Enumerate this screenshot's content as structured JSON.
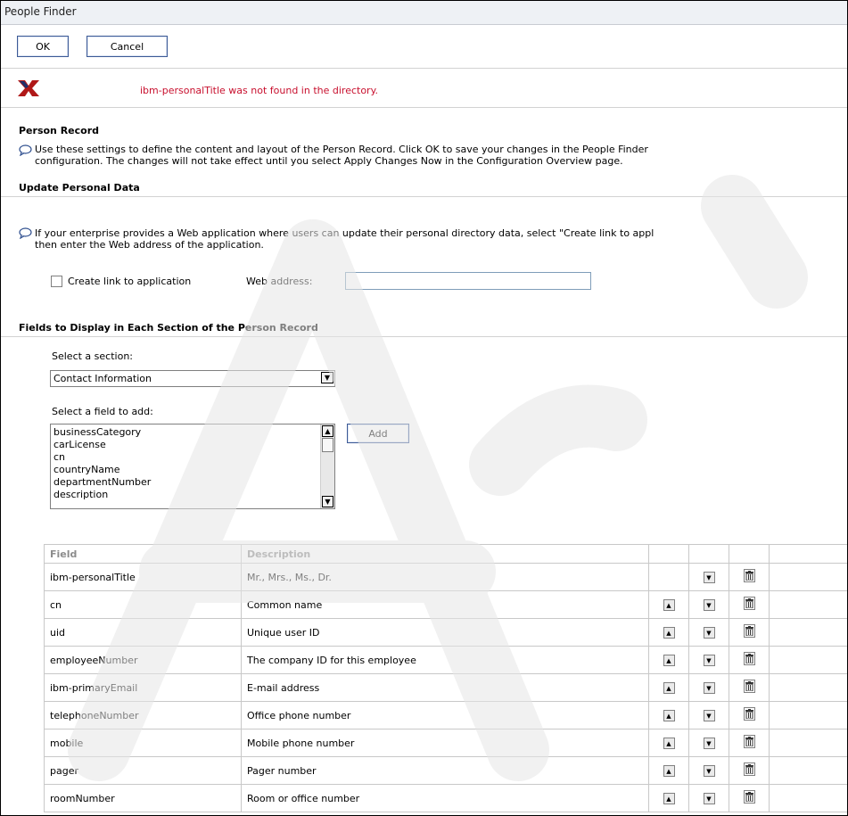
{
  "window": {
    "title": "People Finder"
  },
  "toolbar": {
    "ok_label": "OK",
    "cancel_label": "Cancel"
  },
  "error": {
    "message": "ibm-personalTitle was not found in the directory."
  },
  "person_record": {
    "heading": "Person Record",
    "line1": "Use these settings to define the content and layout of the Person Record. Click OK to save your changes in the People Finder",
    "line2": "configuration. The changes will not take effect until you select Apply Changes Now in the Configuration Overview page."
  },
  "update_personal_data": {
    "heading": "Update Personal Data",
    "line1": "If your enterprise provides a Web application where users can update their personal directory data, select \"Create link to appl",
    "line2": "then enter the Web address of the application.",
    "checkbox_label": "Create link to application",
    "checkbox_checked": false,
    "web_address_label": "Web address:",
    "web_address_value": ""
  },
  "fields_section": {
    "heading": "Fields to Display in Each Section of the Person Record",
    "select_section_label": "Select a section:",
    "select_section_value": "Contact Information",
    "select_field_label": "Select a field to add:",
    "field_options": [
      "businessCategory",
      "carLicense",
      "cn",
      "countryName",
      "departmentNumber",
      "description"
    ],
    "add_label": "Add"
  },
  "table": {
    "headers": {
      "field": "Field",
      "description": "Description"
    },
    "rows": [
      {
        "field": "ibm-personalTitle",
        "description": "Mr., Mrs., Ms., Dr.",
        "has_up": false
      },
      {
        "field": "cn",
        "description": "Common name",
        "has_up": true
      },
      {
        "field": "uid",
        "description": "Unique user ID",
        "has_up": true
      },
      {
        "field": "employeeNumber",
        "description": "The company ID for this employee",
        "has_up": true
      },
      {
        "field": "ibm-primaryEmail",
        "description": "E-mail address",
        "has_up": true
      },
      {
        "field": "telephoneNumber",
        "description": "Office phone number",
        "has_up": true
      },
      {
        "field": "mobile",
        "description": "Mobile phone number",
        "has_up": true
      },
      {
        "field": "pager",
        "description": "Pager number",
        "has_up": true
      },
      {
        "field": "roomNumber",
        "description": "Room or office number",
        "has_up": true
      }
    ]
  },
  "icons": {
    "error": "error-x-icon",
    "info": "speech-bubble-icon",
    "up": "arrow-up-icon",
    "down": "arrow-down-icon",
    "delete": "trash-icon",
    "dropdown": "chevron-down-icon"
  },
  "colors": {
    "error_text": "#c8102e",
    "button_border": "#3c5a96",
    "watermark": "#e6e6e6"
  }
}
